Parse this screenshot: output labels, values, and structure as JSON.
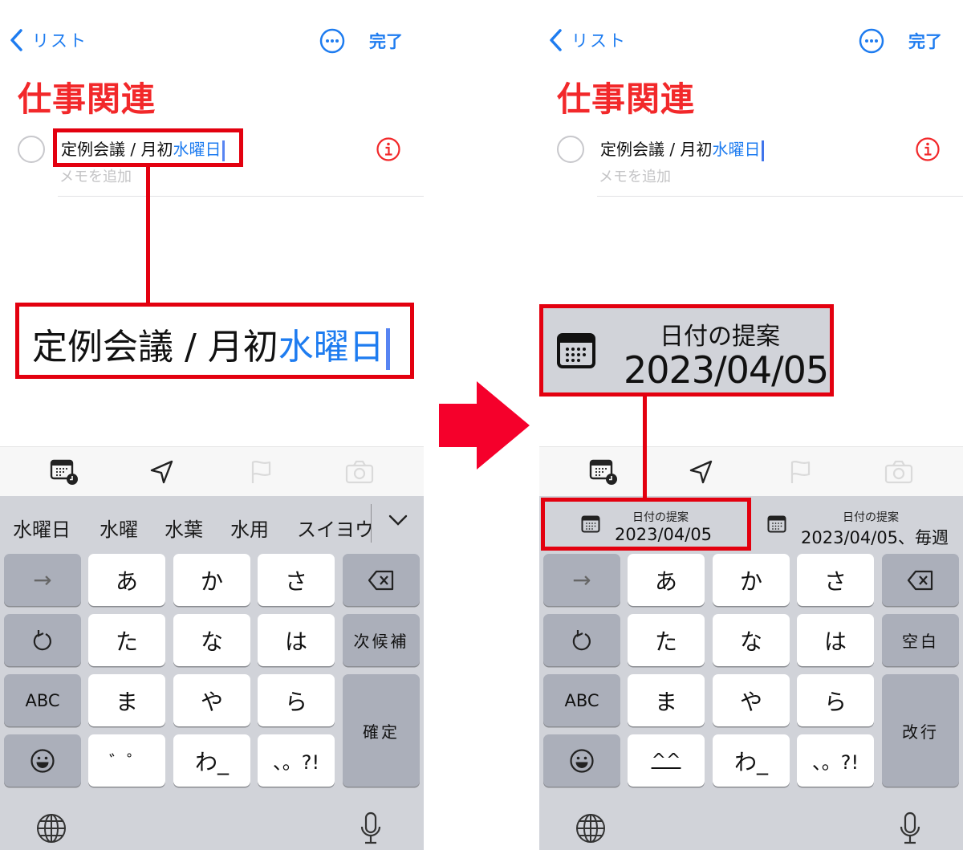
{
  "screens": {
    "before": {
      "nav": {
        "back_label": "リスト",
        "more_icon": "ellipsis-circle-icon",
        "done_label": "完了"
      },
      "list_title": "仕事関連",
      "task": {
        "text_plain": "定例会議 / 月初",
        "text_highlight": "水曜日",
        "note_placeholder": "メモを追加",
        "info_icon": "info-circle-icon"
      },
      "toolbar": [
        "calendar-clock-icon",
        "location-arrow-icon",
        "flag-icon",
        "camera-icon"
      ],
      "candidates": [
        "水曜日",
        "水曜",
        "水葉",
        "水用",
        "スイヨウ"
      ],
      "keys": {
        "row1": [
          "→",
          "あ",
          "か",
          "さ",
          "⌫"
        ],
        "row2": [
          "↺",
          "た",
          "な",
          "は",
          "次候補"
        ],
        "row3": [
          "ABC",
          "ま",
          "や",
          "ら",
          "確定"
        ],
        "row4": [
          "☺",
          "゛゜",
          "わ_",
          "、。?!"
        ]
      },
      "zoom_callout": {
        "text_plain": "定例会議 / 月初",
        "text_highlight": "水曜日"
      }
    },
    "after": {
      "nav": {
        "back_label": "リスト",
        "more_icon": "ellipsis-circle-icon",
        "done_label": "完了"
      },
      "list_title": "仕事関連",
      "task": {
        "text_plain": "定例会議 / 月初",
        "text_highlight": "水曜日",
        "note_placeholder": "メモを追加",
        "info_icon": "info-circle-icon"
      },
      "toolbar": [
        "calendar-clock-icon",
        "location-arrow-icon",
        "flag-icon",
        "camera-icon"
      ],
      "date_suggestions": [
        {
          "title": "日付の提案",
          "value": "2023/04/05"
        },
        {
          "title": "日付の提案",
          "value": "2023/04/05、毎週"
        }
      ],
      "keys": {
        "row1": [
          "→",
          "あ",
          "か",
          "さ",
          "⌫"
        ],
        "row2": [
          "↺",
          "た",
          "な",
          "は",
          "空白"
        ],
        "row3": [
          "ABC",
          "ま",
          "や",
          "ら",
          "改行"
        ],
        "row4": [
          "☺",
          "^^",
          "わ_",
          "、。?!"
        ]
      },
      "zoom_callout": {
        "title": "日付の提案",
        "value": "2023/04/05"
      }
    }
  },
  "colors": {
    "accent_blue": "#1e7cf0",
    "title_red": "#f2282a",
    "annotation_red": "#e3000f",
    "keyboard_bg": "#d1d3d9",
    "key_gray": "#abafba"
  }
}
